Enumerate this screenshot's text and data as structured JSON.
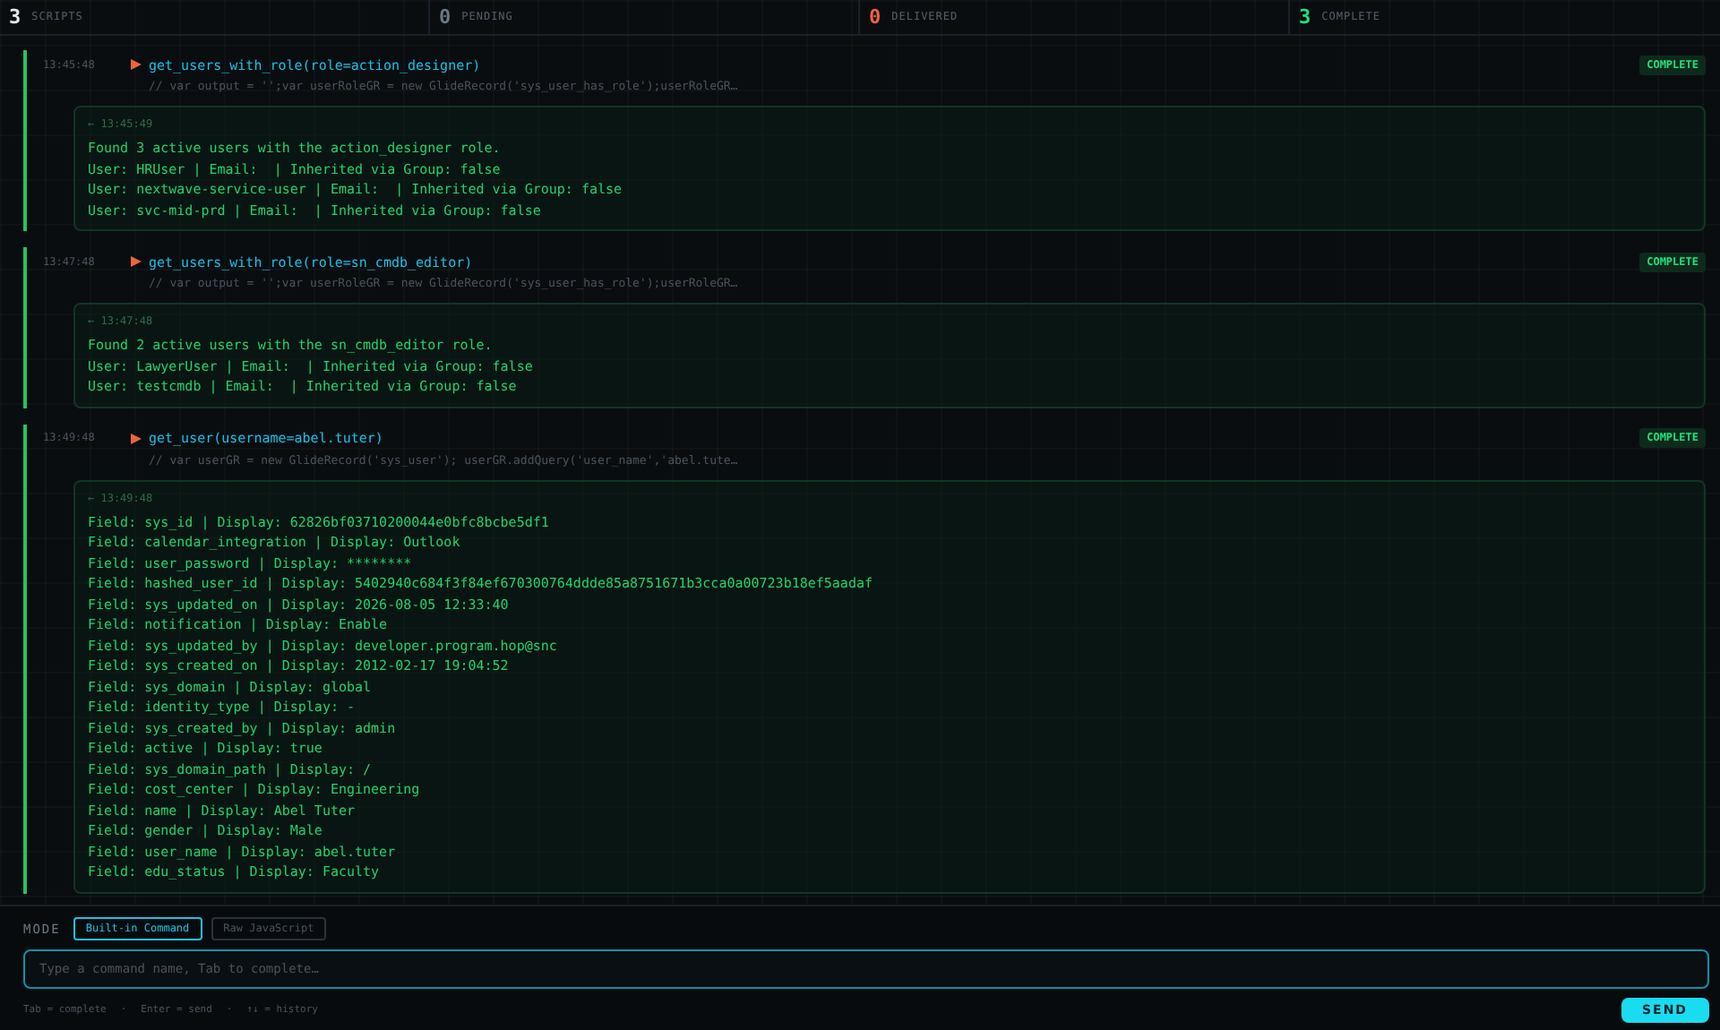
{
  "stats": [
    {
      "count": "3",
      "label": "SCRIPTS",
      "color": "#e8e8e8"
    },
    {
      "count": "0",
      "label": "PENDING",
      "color": "#6b7785"
    },
    {
      "count": "0",
      "label": "DELIVERED",
      "color": "#f0643c"
    },
    {
      "count": "3",
      "label": "COMPLETE",
      "color": "#22e07a"
    }
  ],
  "entries": [
    {
      "time": "13:45:48",
      "command": "get_users_with_role(role=action_designer)",
      "code": "// var output = '';var userRoleGR = new GlideRecord('sys_user_has_role');userRoleGR…",
      "status": "COMPLETE",
      "result_time": "← 13:45:49",
      "lines": [
        "Found 3 active users with the action_designer role.",
        "User: HRUser | Email:  | Inherited via Group: false",
        "User: nextwave-service-user | Email:  | Inherited via Group: false",
        "User: svc-mid-prd | Email:  | Inherited via Group: false"
      ]
    },
    {
      "time": "13:47:48",
      "command": "get_users_with_role(role=sn_cmdb_editor)",
      "code": "// var output = '';var userRoleGR = new GlideRecord('sys_user_has_role');userRoleGR…",
      "status": "COMPLETE",
      "result_time": "← 13:47:48",
      "lines": [
        "Found 2 active users with the sn_cmdb_editor role.",
        "User: LawyerUser | Email:  | Inherited via Group: false",
        "User: testcmdb | Email:  | Inherited via Group: false"
      ]
    },
    {
      "time": "13:49:48",
      "command": "get_user(username=abel.tuter)",
      "code": "// var userGR = new GlideRecord('sys_user'); userGR.addQuery('user_name','abel.tute…",
      "status": "COMPLETE",
      "result_time": "← 13:49:48",
      "lines": [
        "Field: sys_id | Display: 62826bf03710200044e0bfc8bcbe5df1",
        "Field: calendar_integration | Display: Outlook",
        "Field: user_password | Display: ********",
        "Field: hashed_user_id | Display: 5402940c684f3f84ef670300764ddde85a8751671b3cca0a00723b18ef5aadaf",
        "Field: sys_updated_on | Display: 2026-08-05 12:33:40",
        "Field: notification | Display: Enable",
        "Field: sys_updated_by | Display: developer.program.hop@snc",
        "Field: sys_created_on | Display: 2012-02-17 19:04:52",
        "Field: sys_domain | Display: global",
        "Field: identity_type | Display: -",
        "Field: sys_created_by | Display: admin",
        "Field: active | Display: true",
        "Field: sys_domain_path | Display: /",
        "Field: cost_center | Display: Engineering",
        "Field: name | Display: Abel Tuter",
        "Field: gender | Display: Male",
        "Field: user_name | Display: abel.tuter",
        "Field: edu_status | Display: Faculty"
      ]
    }
  ],
  "mode": {
    "label": "MODE",
    "options": [
      {
        "label": "Built-in Command",
        "selected": true
      },
      {
        "label": "Raw JavaScript",
        "selected": false
      }
    ]
  },
  "input": {
    "placeholder": "Type a command name, Tab to complete…"
  },
  "hints": {
    "items": [
      "Tab = complete",
      "Enter = send",
      "↑↓ = history"
    ],
    "separator": "·"
  },
  "send": "SEND"
}
